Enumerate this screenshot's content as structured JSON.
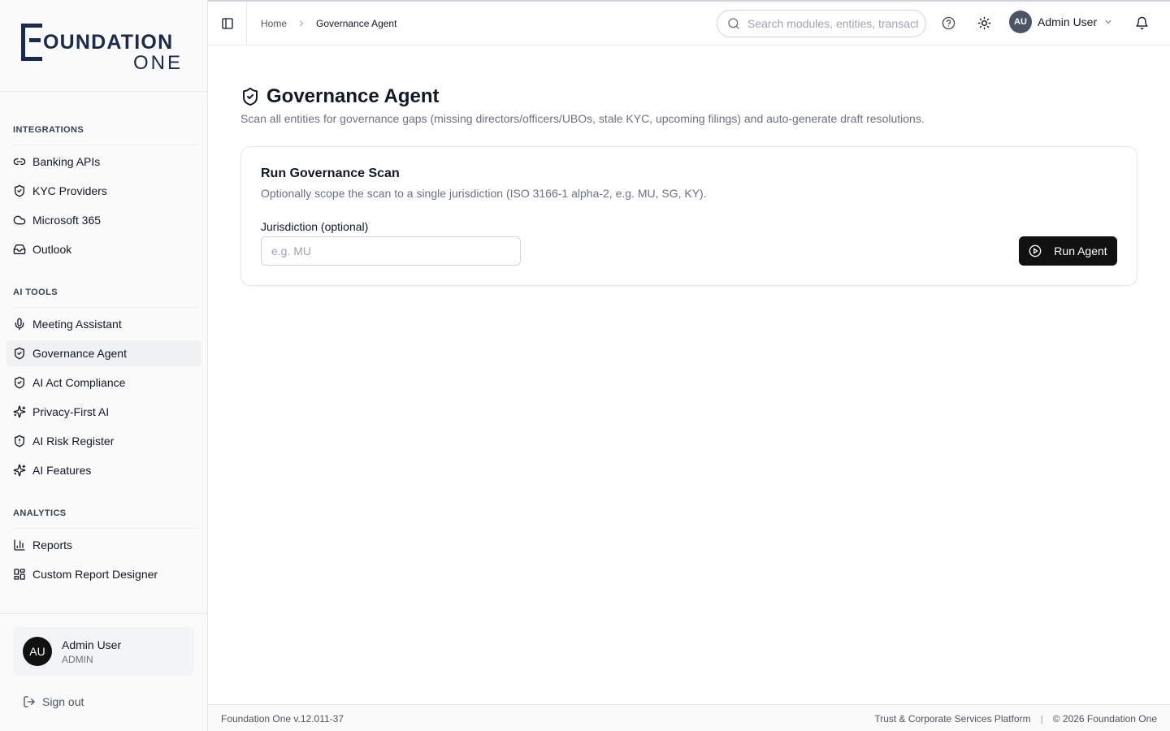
{
  "brand": {
    "logo_line1": "OUNDATION",
    "logo_line2": "ONE",
    "navy": "#1c2a4a"
  },
  "sidebar": {
    "sections": [
      {
        "title": "INTEGRATIONS",
        "items": [
          {
            "label": "Banking APIs",
            "icon": "link-icon"
          },
          {
            "label": "KYC Providers",
            "icon": "shield-check-icon"
          },
          {
            "label": "Microsoft 365",
            "icon": "cloud-icon"
          },
          {
            "label": "Outlook",
            "icon": "inbox-icon"
          }
        ]
      },
      {
        "title": "AI TOOLS",
        "items": [
          {
            "label": "Meeting Assistant",
            "icon": "microphone-icon"
          },
          {
            "label": "Governance Agent",
            "icon": "shield-check-icon",
            "active": true
          },
          {
            "label": "AI Act Compliance",
            "icon": "shield-check-icon"
          },
          {
            "label": "Privacy-First AI",
            "icon": "sparkles-icon"
          },
          {
            "label": "AI Risk Register",
            "icon": "shield-alert-icon"
          },
          {
            "label": "AI Features",
            "icon": "sparkles-icon"
          }
        ]
      },
      {
        "title": "ANALYTICS",
        "items": [
          {
            "label": "Reports",
            "icon": "bar-chart-icon"
          },
          {
            "label": "Custom Report Designer",
            "icon": "layout-grid-icon"
          }
        ]
      }
    ],
    "user": {
      "initials": "AU",
      "name": "Admin User",
      "role": "ADMIN"
    },
    "signout_label": "Sign out"
  },
  "header": {
    "breadcrumb": {
      "home": "Home",
      "current": "Governance Agent"
    },
    "search_placeholder": "Search modules, entities, transactions...",
    "user": {
      "initials": "AU",
      "name": "Admin User"
    }
  },
  "main": {
    "title": "Governance Agent",
    "description": "Scan all entities for governance gaps (missing directors/officers/UBOs, stale KYC, upcoming filings) and auto-generate draft resolutions.",
    "card": {
      "title": "Run Governance Scan",
      "description": "Optionally scope the scan to a single jurisdiction (ISO 3166-1 alpha-2, e.g. MU, SG, KY).",
      "field_label": "Jurisdiction (optional)",
      "field_placeholder": "e.g. MU",
      "field_value": "",
      "button_label": "Run Agent"
    }
  },
  "footer": {
    "version": "Foundation One v.12.011-37",
    "platform": "Trust & Corporate Services Platform",
    "separator": "|",
    "copyright": "© 2026 Foundation One"
  }
}
